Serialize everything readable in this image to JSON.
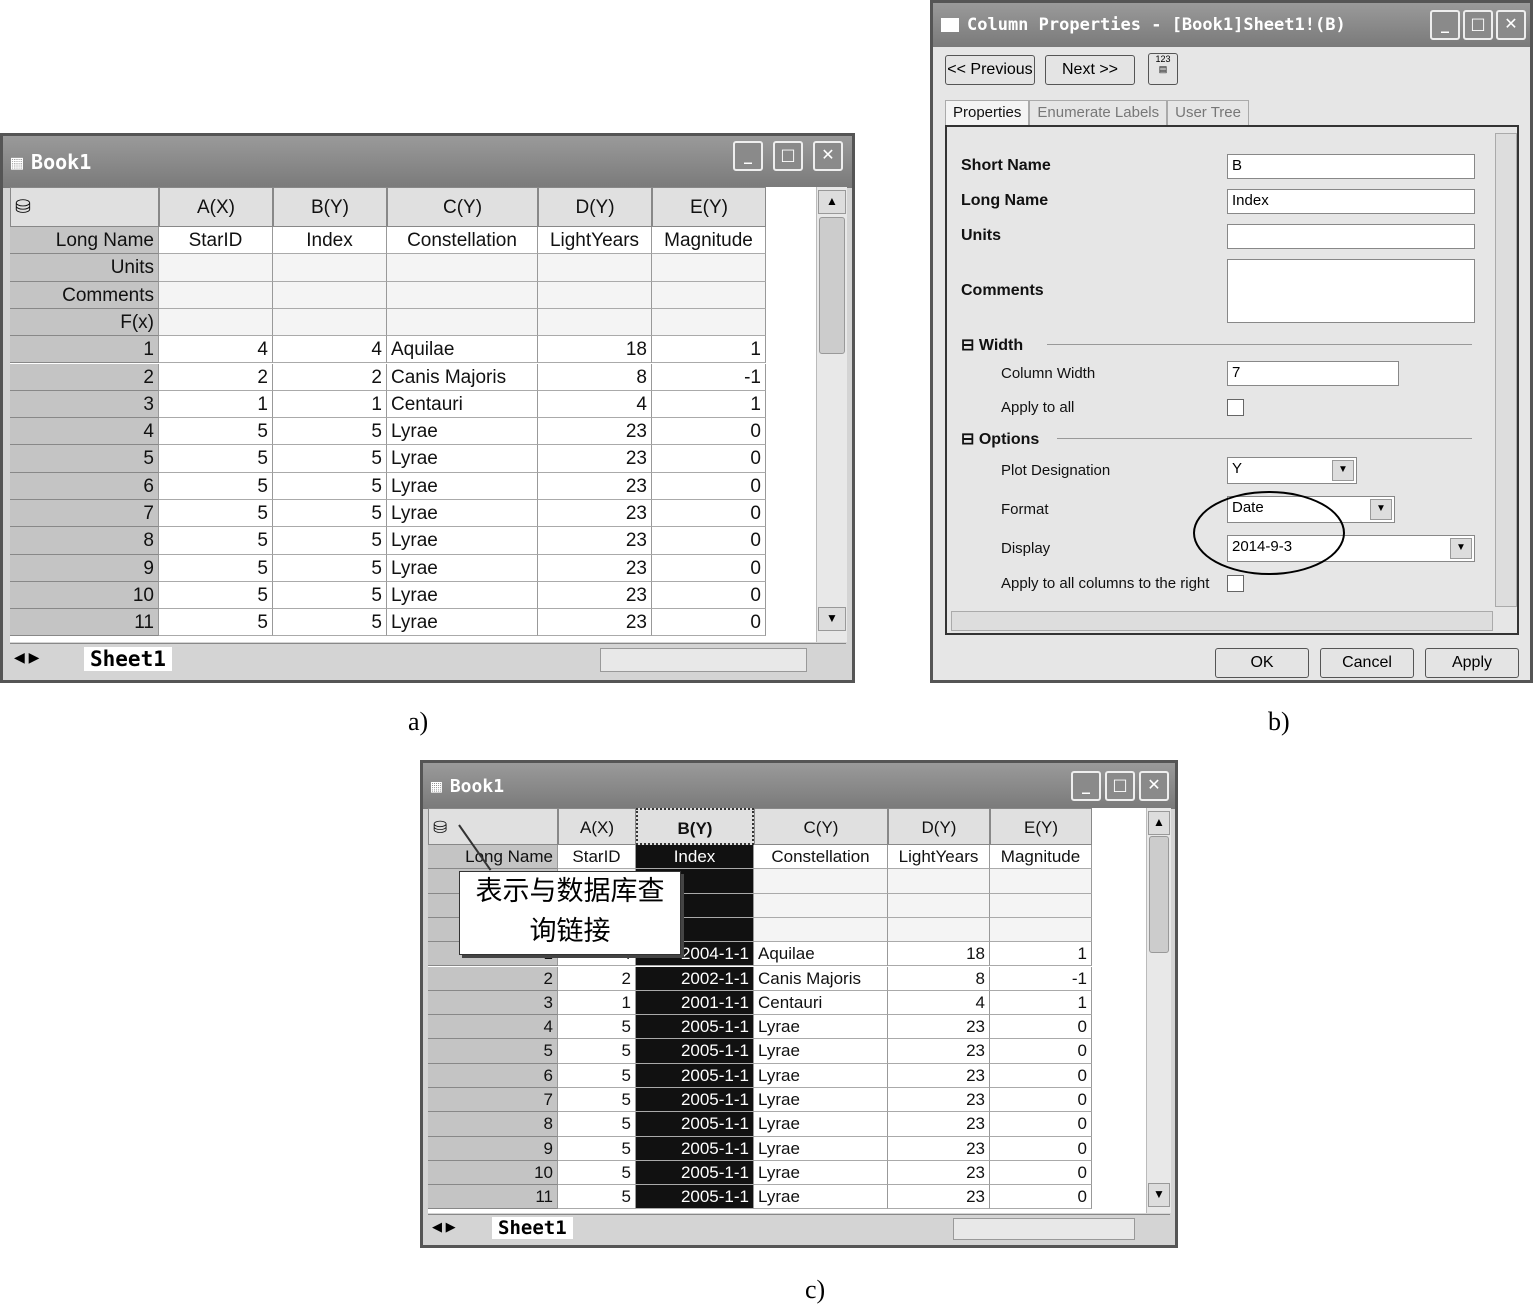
{
  "captions": {
    "a": "a)",
    "b": "b)",
    "c": "c)"
  },
  "book": {
    "title": "Book1",
    "columns": [
      "A(X)",
      "B(Y)",
      "C(Y)",
      "D(Y)",
      "E(Y)"
    ],
    "meta_labels": [
      "Long Name",
      "Units",
      "Comments",
      "F(x)"
    ],
    "long_names": [
      "StarID",
      "Index",
      "Constellation",
      "LightYears",
      "Magnitude"
    ],
    "rows": [
      [
        "1",
        "4",
        "4",
        "Aquilae",
        "18",
        "1"
      ],
      [
        "2",
        "2",
        "2",
        "Canis Majoris",
        "8",
        "-1"
      ],
      [
        "3",
        "1",
        "1",
        "Centauri",
        "4",
        "1"
      ],
      [
        "4",
        "5",
        "5",
        "Lyrae",
        "23",
        "0"
      ],
      [
        "5",
        "5",
        "5",
        "Lyrae",
        "23",
        "0"
      ],
      [
        "6",
        "5",
        "5",
        "Lyrae",
        "23",
        "0"
      ],
      [
        "7",
        "5",
        "5",
        "Lyrae",
        "23",
        "0"
      ],
      [
        "8",
        "5",
        "5",
        "Lyrae",
        "23",
        "0"
      ],
      [
        "9",
        "5",
        "5",
        "Lyrae",
        "23",
        "0"
      ],
      [
        "10",
        "5",
        "5",
        "Lyrae",
        "23",
        "0"
      ],
      [
        "11",
        "5",
        "5",
        "Lyrae",
        "23",
        "0"
      ]
    ],
    "sheet_tab": "Sheet1"
  },
  "book_c": {
    "title": "Book1",
    "dates": [
      "2004-1-1",
      "2002-1-1",
      "2001-1-1",
      "2005-1-1",
      "2005-1-1",
      "2005-1-1",
      "2005-1-1",
      "2005-1-1",
      "2005-1-1",
      "2005-1-1",
      "2005-1-1"
    ],
    "callout": [
      "表示与数据库查",
      "询链接"
    ]
  },
  "dialog": {
    "title": "Column Properties - [Book1]Sheet1!(B)",
    "previous": "<< Previous",
    "next": "Next >>",
    "tabs": [
      "Properties",
      "Enumerate Labels",
      "User Tree"
    ],
    "short_name_label": "Short Name",
    "short_name": "B",
    "long_name_label": "Long Name",
    "long_name": "Index",
    "units_label": "Units",
    "units": "",
    "comments_label": "Comments",
    "comments": "",
    "width_section": "Width",
    "column_width_label": "Column Width",
    "column_width": "7",
    "apply_all_label": "Apply to all",
    "options_section": "Options",
    "plot_designation_label": "Plot Designation",
    "plot_designation": "Y",
    "format_label": "Format",
    "format": "Date",
    "display_label": "Display",
    "display": "2014-9-3",
    "apply_right_label": "Apply to all columns to the right",
    "ok": "OK",
    "cancel": "Cancel",
    "apply": "Apply"
  }
}
